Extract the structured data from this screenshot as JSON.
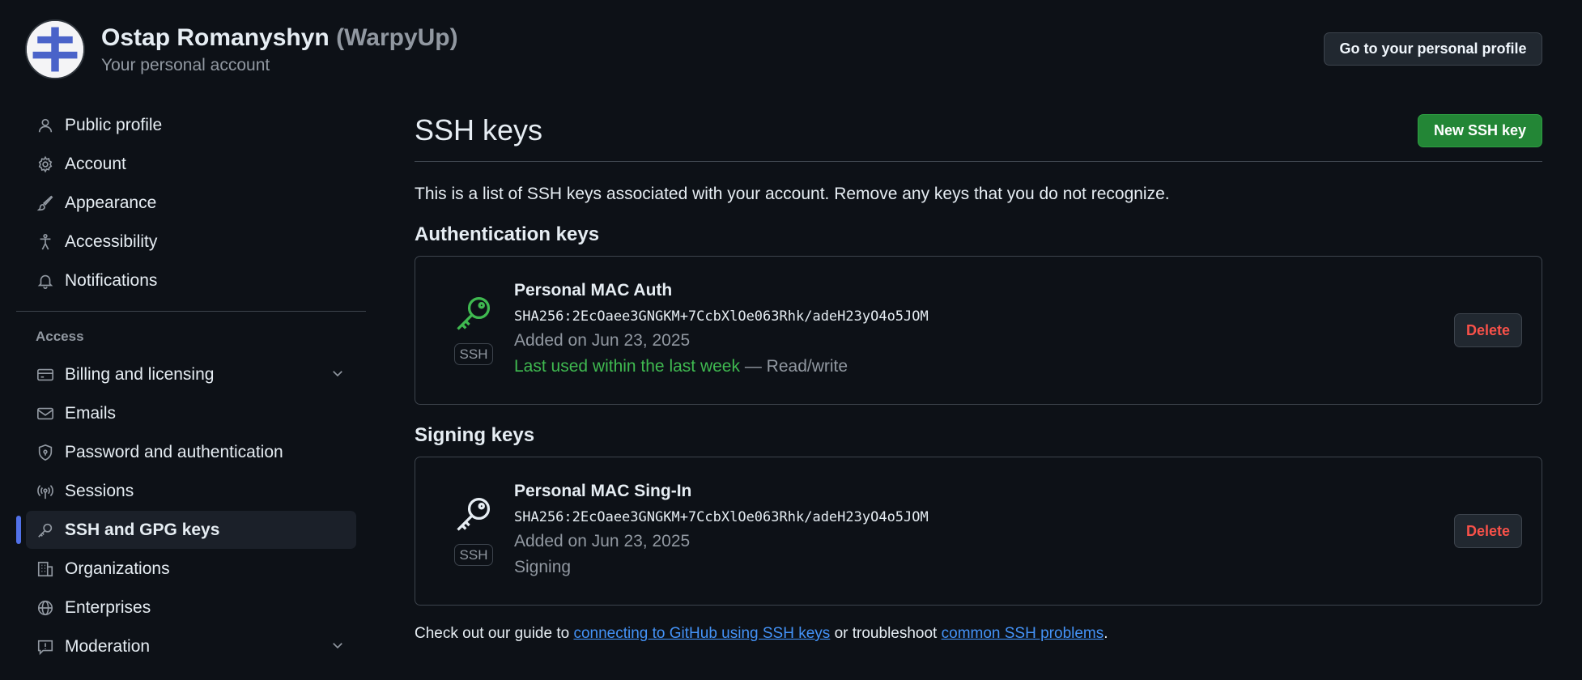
{
  "header": {
    "name": "Ostap Romanyshyn",
    "handle": "(WarpyUp)",
    "subtitle": "Your personal account",
    "profile_button": "Go to your personal profile"
  },
  "sidebar": {
    "items": [
      {
        "label": "Public profile",
        "icon": "person-icon"
      },
      {
        "label": "Account",
        "icon": "gear-icon"
      },
      {
        "label": "Appearance",
        "icon": "paintbrush-icon"
      },
      {
        "label": "Accessibility",
        "icon": "accessibility-icon"
      },
      {
        "label": "Notifications",
        "icon": "bell-icon"
      }
    ],
    "access_label": "Access",
    "access_items": [
      {
        "label": "Billing and licensing",
        "icon": "credit-card-icon",
        "expandable": true
      },
      {
        "label": "Emails",
        "icon": "mail-icon"
      },
      {
        "label": "Password and authentication",
        "icon": "shield-lock-icon"
      },
      {
        "label": "Sessions",
        "icon": "broadcast-icon"
      },
      {
        "label": "SSH and GPG keys",
        "icon": "key-icon",
        "active": true
      },
      {
        "label": "Organizations",
        "icon": "organization-icon"
      },
      {
        "label": "Enterprises",
        "icon": "globe-icon"
      },
      {
        "label": "Moderation",
        "icon": "report-icon",
        "expandable": true
      }
    ]
  },
  "main": {
    "title": "SSH keys",
    "new_button": "New SSH key",
    "intro": "This is a list of SSH keys associated with your account. Remove any keys that you do not recognize.",
    "auth_section_title": "Authentication keys",
    "signing_section_title": "Signing keys",
    "auth_key": {
      "name": "Personal MAC Auth",
      "fingerprint": "SHA256:2EcOaee3GNGKM+7CcbXlOe063Rhk/adeH23yO4o5JOM",
      "added": "Added on Jun 23, 2025",
      "last_used": "Last used within the last week",
      "access": " — Read/write",
      "badge": "SSH",
      "delete_label": "Delete",
      "icon_color": "#3fb950"
    },
    "signing_key": {
      "name": "Personal MAC Sing-In",
      "fingerprint": "SHA256:2EcOaee3GNGKM+7CcbXlOe063Rhk/adeH23yO4o5JOM",
      "added": "Added on Jun 23, 2025",
      "usage": "Signing",
      "badge": "SSH",
      "delete_label": "Delete",
      "icon_color": "#e6edf3"
    },
    "footer": {
      "prefix": "Check out our guide to ",
      "link1": "connecting to GitHub using SSH keys",
      "middle": " or troubleshoot ",
      "link2": "common SSH problems",
      "suffix": "."
    }
  },
  "colors": {
    "background": "#0d1117",
    "accent_active": "#5171e8",
    "primary_button": "#238636",
    "danger": "#f85149",
    "link": "#4493f8"
  }
}
